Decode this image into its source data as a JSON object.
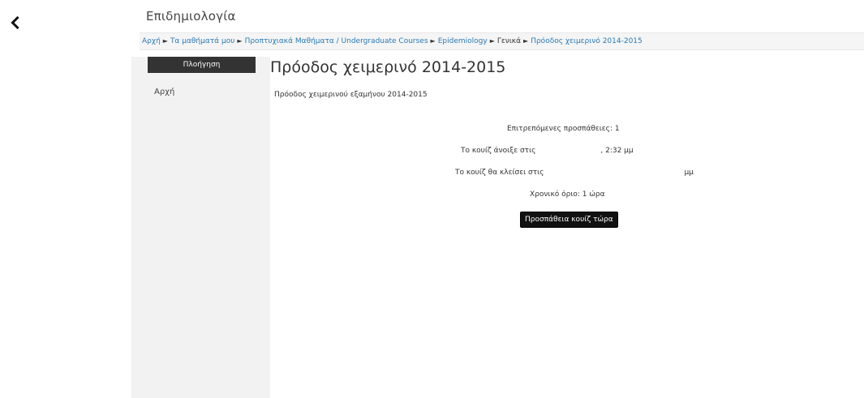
{
  "header": {
    "back_icon": "chevron-left-icon",
    "course_title": "Επιδημιολογία"
  },
  "breadcrumb": {
    "items": [
      "Αρχή",
      "Τα μαθήματά μου",
      "Προπτυχιακά Μαθήματα / Undergraduate Courses",
      "Epidemiology",
      "Γενικά",
      "Πρόοδος χειμερινό 2014-2015"
    ],
    "separator": "►"
  },
  "sidebar": {
    "header": "Πλοήγηση",
    "items": [
      "Αρχή"
    ]
  },
  "main": {
    "title": "Πρόοδος χειμερινό 2014-2015",
    "intro": "Πρόοδος χειμερινού εξαμήνου 2014-2015",
    "quiz_info": {
      "attempts_allowed": "Επιτρεπόμενες προσπάθειες: 1",
      "opened_label": "Το κουίζ άνοιξε στις",
      "opened_time": ", 2:32 μμ",
      "closes_label": "Το κουίζ θα κλείσει στις",
      "closes_time": "μμ",
      "time_limit": "Χρονικό όριο: 1 ώρα"
    },
    "attempt_button": "Προσπάθεια κουίζ τώρα"
  },
  "colors": {
    "link": "#2a7ab5",
    "sidebar_bg": "#f2f2f2",
    "header_dark": "#333333",
    "button_bg": "#111111"
  }
}
